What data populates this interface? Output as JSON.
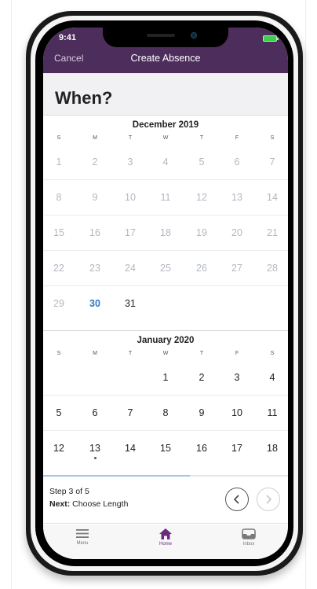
{
  "status_bar": {
    "time": "9:41"
  },
  "header": {
    "cancel_label": "Cancel",
    "title": "Create Absence"
  },
  "question": {
    "title": "When?"
  },
  "day_labels": [
    "S",
    "M",
    "T",
    "W",
    "T",
    "F",
    "S"
  ],
  "calendar": {
    "months": [
      {
        "title": "December 2019",
        "weeks": [
          [
            "1",
            "2",
            "3",
            "4",
            "5",
            "6",
            "7"
          ],
          [
            "8",
            "9",
            "10",
            "11",
            "12",
            "13",
            "14"
          ],
          [
            "15",
            "16",
            "17",
            "18",
            "19",
            "20",
            "21"
          ],
          [
            "22",
            "23",
            "24",
            "25",
            "26",
            "27",
            "28"
          ],
          [
            "29",
            "30",
            "31",
            "",
            "",
            "",
            ""
          ]
        ]
      },
      {
        "title": "January 2020",
        "weeks": [
          [
            "",
            "",
            "",
            "1",
            "2",
            "3",
            "4"
          ],
          [
            "5",
            "6",
            "7",
            "8",
            "9",
            "10",
            "11"
          ],
          [
            "12",
            "13",
            "14",
            "15",
            "16",
            "17",
            "18"
          ]
        ]
      }
    ],
    "today": "30",
    "last_past_day": "29"
  },
  "step": {
    "count_text": "Step 3 of 5",
    "next_label": "Next:",
    "next_value": " Choose Length",
    "progress": 0.6
  },
  "tabs": [
    {
      "label": "Menu",
      "icon": "menu-icon"
    },
    {
      "label": "Home",
      "icon": "home-icon"
    },
    {
      "label": "Inbox",
      "icon": "inbox-icon"
    }
  ],
  "colors": {
    "header_bg": "#4d2d5c",
    "today": "#2b78c5",
    "active_tab": "#6a2a7f",
    "past_day": "#b2b8c2"
  }
}
